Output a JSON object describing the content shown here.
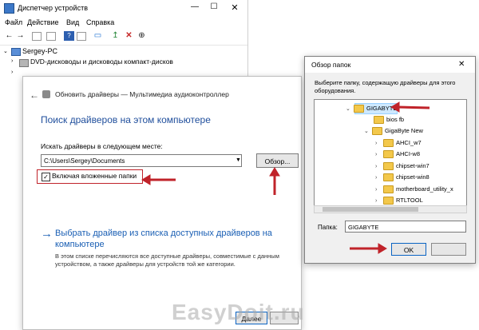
{
  "device_manager": {
    "title": "Диспетчер устройств",
    "menu": [
      "Файл",
      "Действие",
      "Вид",
      "Справка"
    ],
    "tree": {
      "computer": "Sergey-PC",
      "item": "DVD-дисководы и дисководы компакт-дисков"
    }
  },
  "wizard": {
    "header": "Обновить драйверы — Мультимедиа аудиоконтроллер",
    "heading": "Поиск драйверов на этом компьютере",
    "search_label": "Искать драйверы в следующем месте:",
    "path_value": "C:\\Users\\Sergey\\Documents",
    "browse_label": "Обзор...",
    "include_subfolders_label": "Включая вложенные папки",
    "include_subfolders_checked": true,
    "pick_link": "Выбрать драйвер из списка доступных драйверов на компьютере",
    "pick_desc": "В этом списке перечисляются все доступные драйверы, совместимые с данным устройством, а также драйверы для устройств той же категории.",
    "next_label": "Далее"
  },
  "browse_dialog": {
    "title": "Обзор папок",
    "instruction": "Выберите папку, содержащую драйверы для этого оборудования.",
    "folders": [
      {
        "name": "GIGABYTE",
        "selected": true,
        "expanded": true
      },
      {
        "name": "bios fb",
        "selected": false,
        "expanded": false
      },
      {
        "name": "GigaByte New",
        "selected": false,
        "expanded": true
      },
      {
        "name": "AHCI_w7",
        "selected": false,
        "expanded": false
      },
      {
        "name": "AHCI-w8",
        "selected": false,
        "expanded": false
      },
      {
        "name": "chipset-win7",
        "selected": false,
        "expanded": false
      },
      {
        "name": "chipset-win8",
        "selected": false,
        "expanded": false
      },
      {
        "name": "motherboard_utility_x",
        "selected": false,
        "expanded": false
      },
      {
        "name": "RTLTOOL",
        "selected": false,
        "expanded": false
      }
    ],
    "folder_label": "Папка:",
    "folder_value": "GIGABYTE",
    "ok_label": "OK"
  },
  "watermark": "EasyDoit.ru",
  "colors": {
    "accent": "#1a5fb4",
    "highlight_red": "#c0232a",
    "folder": "#f3c84b"
  }
}
